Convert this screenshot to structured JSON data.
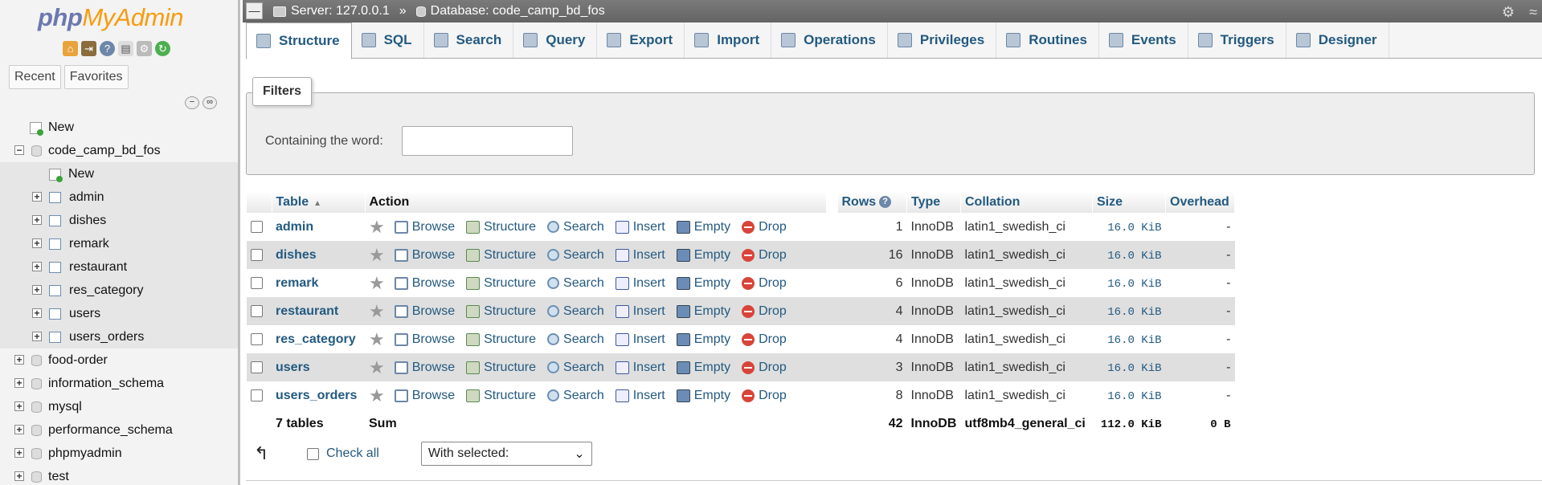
{
  "sidebar": {
    "logo": {
      "php": "php",
      "myadmin": "MyAdmin"
    },
    "recent": "Recent",
    "favorites": "Favorites",
    "tree": [
      {
        "label": "New",
        "type": "new",
        "level": 0
      },
      {
        "label": "code_camp_bd_fos",
        "type": "db",
        "level": 0,
        "expanded": true
      },
      {
        "label": "New",
        "type": "new",
        "level": 1
      },
      {
        "label": "admin",
        "type": "table",
        "level": 1
      },
      {
        "label": "dishes",
        "type": "table",
        "level": 1
      },
      {
        "label": "remark",
        "type": "table",
        "level": 1
      },
      {
        "label": "restaurant",
        "type": "table",
        "level": 1
      },
      {
        "label": "res_category",
        "type": "table",
        "level": 1
      },
      {
        "label": "users",
        "type": "table",
        "level": 1
      },
      {
        "label": "users_orders",
        "type": "table",
        "level": 1
      },
      {
        "label": "food-order",
        "type": "db",
        "level": 0
      },
      {
        "label": "information_schema",
        "type": "db",
        "level": 0
      },
      {
        "label": "mysql",
        "type": "db",
        "level": 0
      },
      {
        "label": "performance_schema",
        "type": "db",
        "level": 0
      },
      {
        "label": "phpmyadmin",
        "type": "db",
        "level": 0
      },
      {
        "label": "test",
        "type": "db",
        "level": 0
      }
    ]
  },
  "breadcrumb": {
    "server": "Server: 127.0.0.1",
    "sep": "»",
    "database": "Database: code_camp_bd_fos"
  },
  "tabs": [
    {
      "label": "Structure",
      "icon": "structure-icon",
      "active": true
    },
    {
      "label": "SQL",
      "icon": "sql-icon"
    },
    {
      "label": "Search",
      "icon": "search-icon"
    },
    {
      "label": "Query",
      "icon": "query-icon"
    },
    {
      "label": "Export",
      "icon": "export-icon"
    },
    {
      "label": "Import",
      "icon": "import-icon"
    },
    {
      "label": "Operations",
      "icon": "wrench-icon"
    },
    {
      "label": "Privileges",
      "icon": "privileges-icon"
    },
    {
      "label": "Routines",
      "icon": "routines-icon"
    },
    {
      "label": "Events",
      "icon": "events-icon"
    },
    {
      "label": "Triggers",
      "icon": "triggers-icon"
    },
    {
      "label": "Designer",
      "icon": "designer-icon"
    }
  ],
  "filters": {
    "legend": "Filters",
    "label": "Containing the word:",
    "value": ""
  },
  "table": {
    "headers": {
      "table": "Table",
      "action": "Action",
      "rows": "Rows",
      "type": "Type",
      "collation": "Collation",
      "size": "Size",
      "overhead": "Overhead"
    },
    "actions": [
      "Browse",
      "Structure",
      "Search",
      "Insert",
      "Empty",
      "Drop"
    ],
    "rows": [
      {
        "name": "admin",
        "rows": "1",
        "type": "InnoDB",
        "collation": "latin1_swedish_ci",
        "size": "16.0 KiB",
        "overhead": "-"
      },
      {
        "name": "dishes",
        "rows": "16",
        "type": "InnoDB",
        "collation": "latin1_swedish_ci",
        "size": "16.0 KiB",
        "overhead": "-"
      },
      {
        "name": "remark",
        "rows": "6",
        "type": "InnoDB",
        "collation": "latin1_swedish_ci",
        "size": "16.0 KiB",
        "overhead": "-"
      },
      {
        "name": "restaurant",
        "rows": "4",
        "type": "InnoDB",
        "collation": "latin1_swedish_ci",
        "size": "16.0 KiB",
        "overhead": "-"
      },
      {
        "name": "res_category",
        "rows": "4",
        "type": "InnoDB",
        "collation": "latin1_swedish_ci",
        "size": "16.0 KiB",
        "overhead": "-"
      },
      {
        "name": "users",
        "rows": "3",
        "type": "InnoDB",
        "collation": "latin1_swedish_ci",
        "size": "16.0 KiB",
        "overhead": "-"
      },
      {
        "name": "users_orders",
        "rows": "8",
        "type": "InnoDB",
        "collation": "latin1_swedish_ci",
        "size": "16.0 KiB",
        "overhead": "-"
      }
    ],
    "summary": {
      "count": "7 tables",
      "label": "Sum",
      "rows": "42",
      "type": "InnoDB",
      "collation": "utf8mb4_general_ci",
      "size": "112.0 KiB",
      "overhead": "0 B"
    }
  },
  "footer": {
    "check_all": "Check all",
    "with_selected": "With selected:"
  },
  "colors": {
    "link": "#235a81",
    "sidebar_bg": "#f3f3f3",
    "topbar": "#6f6f6f",
    "row_alt": "#dfdfdf"
  }
}
